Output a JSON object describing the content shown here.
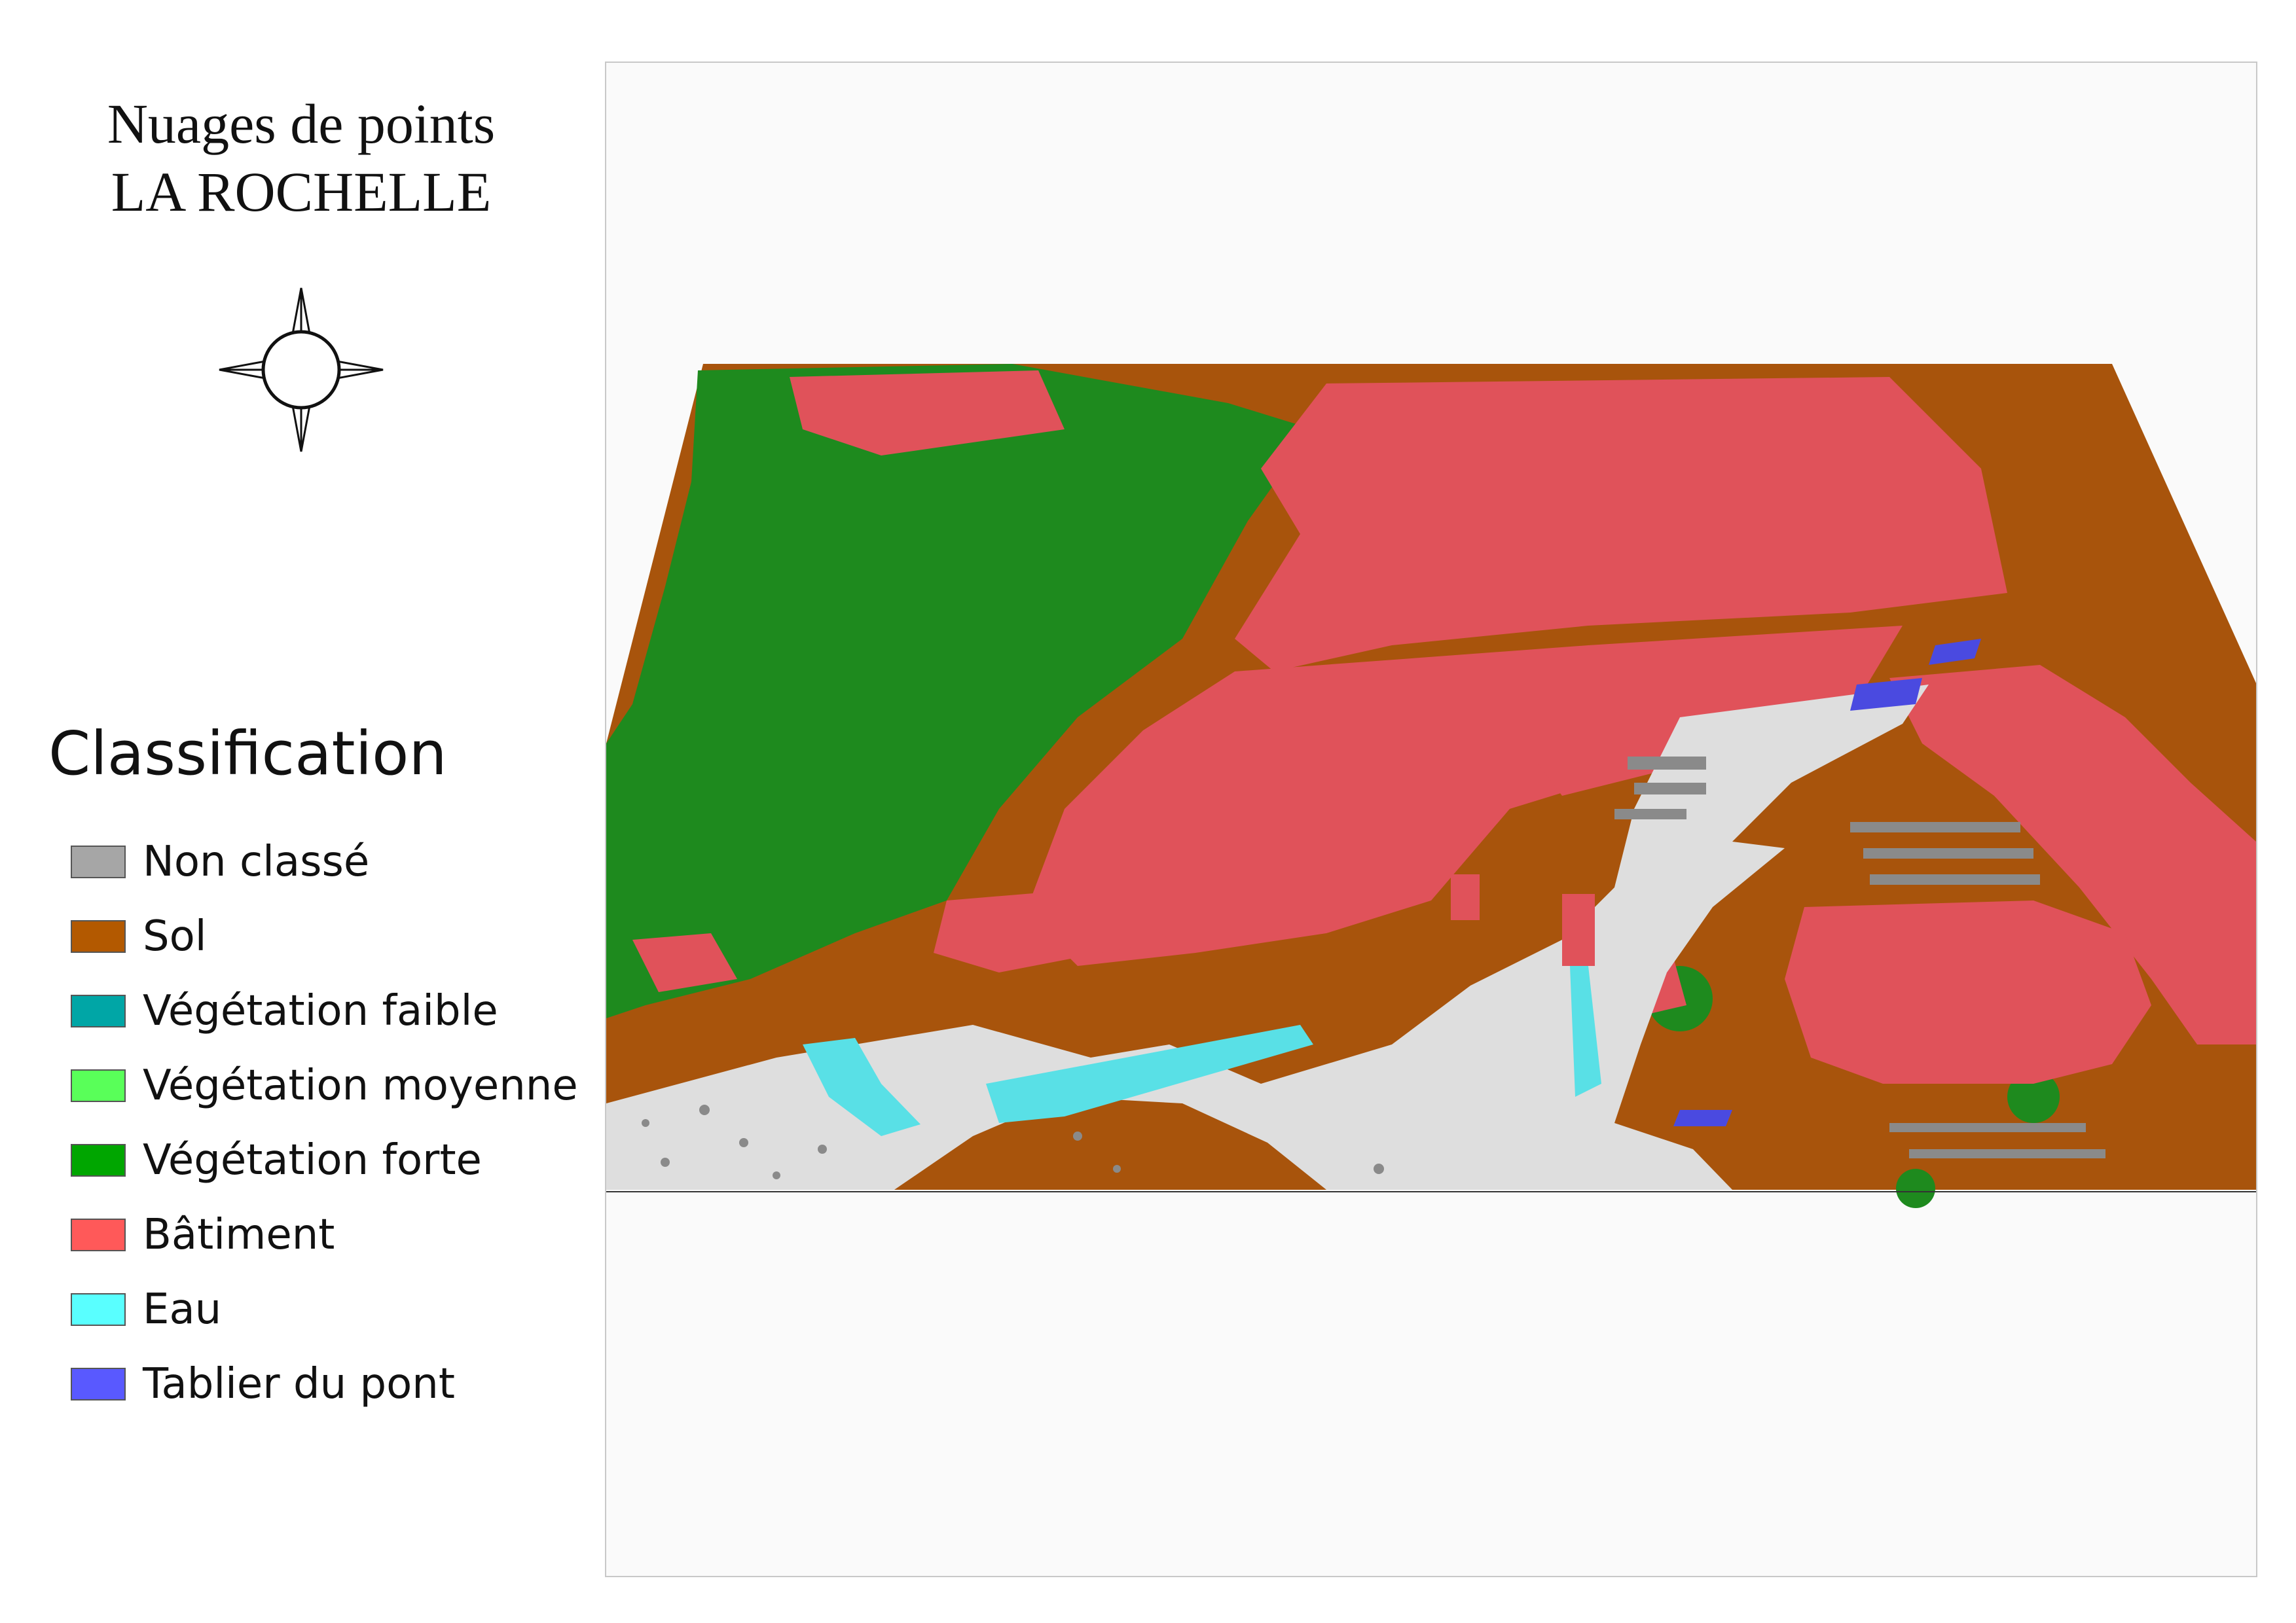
{
  "title": {
    "line1": "Nuages de points",
    "line2": "LA ROCHELLE"
  },
  "compass": {
    "icon": "compass-rose-icon"
  },
  "legend": {
    "title": "Classification",
    "items": [
      {
        "label": "Non classé",
        "color": "#a6a6a6"
      },
      {
        "label": "Sol",
        "color": "#b35900"
      },
      {
        "label": "Végétation faible",
        "color": "#00a6a6"
      },
      {
        "label": "Végétation moyenne",
        "color": "#59ff59"
      },
      {
        "label": "Végétation forte",
        "color": "#00a600"
      },
      {
        "label": "Bâtiment",
        "color": "#ff5959"
      },
      {
        "label": "Eau",
        "color": "#59ffff"
      },
      {
        "label": "Tablier du pont",
        "color": "#5959ff"
      }
    ]
  },
  "map": {
    "colors": {
      "ground": "#a8540c",
      "vegetation": "#1e8a1e",
      "building": "#e0525a",
      "water_surface": "#dedede",
      "water_edge": "#59e0e6",
      "bridge": "#4a4ae0",
      "unclassified": "#8a8a8a"
    }
  }
}
